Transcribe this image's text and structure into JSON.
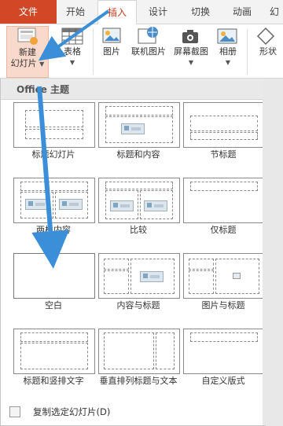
{
  "tabs": {
    "file": "文件",
    "home": "开始",
    "insert": "插入",
    "design": "设计",
    "transitions": "切换",
    "animations": "动画",
    "more": "幻"
  },
  "ribbon": {
    "new_slide_line1": "新建",
    "new_slide_line2": "幻灯片",
    "table": "表格",
    "picture": "图片",
    "online_picture": "联机图片",
    "screenshot": "屏幕截图",
    "album": "相册",
    "shapes": "形状"
  },
  "gallery": {
    "header": "Office 主题",
    "layouts": [
      {
        "label": "标题幻灯片"
      },
      {
        "label": "标题和内容"
      },
      {
        "label": "节标题"
      },
      {
        "label": "两栏内容"
      },
      {
        "label": "比较"
      },
      {
        "label": "仅标题"
      },
      {
        "label": "空白"
      },
      {
        "label": "内容与标题"
      },
      {
        "label": "图片与标题"
      },
      {
        "label": "标题和竖排文字"
      },
      {
        "label": "垂直排列标题与文本"
      },
      {
        "label": "自定义版式"
      }
    ]
  },
  "menu": {
    "duplicate": "复制选定幻灯片(D)"
  },
  "colors": {
    "file_tab": "#d24726",
    "accent": "#c43e1c",
    "arrow": "#3a8fd8"
  }
}
